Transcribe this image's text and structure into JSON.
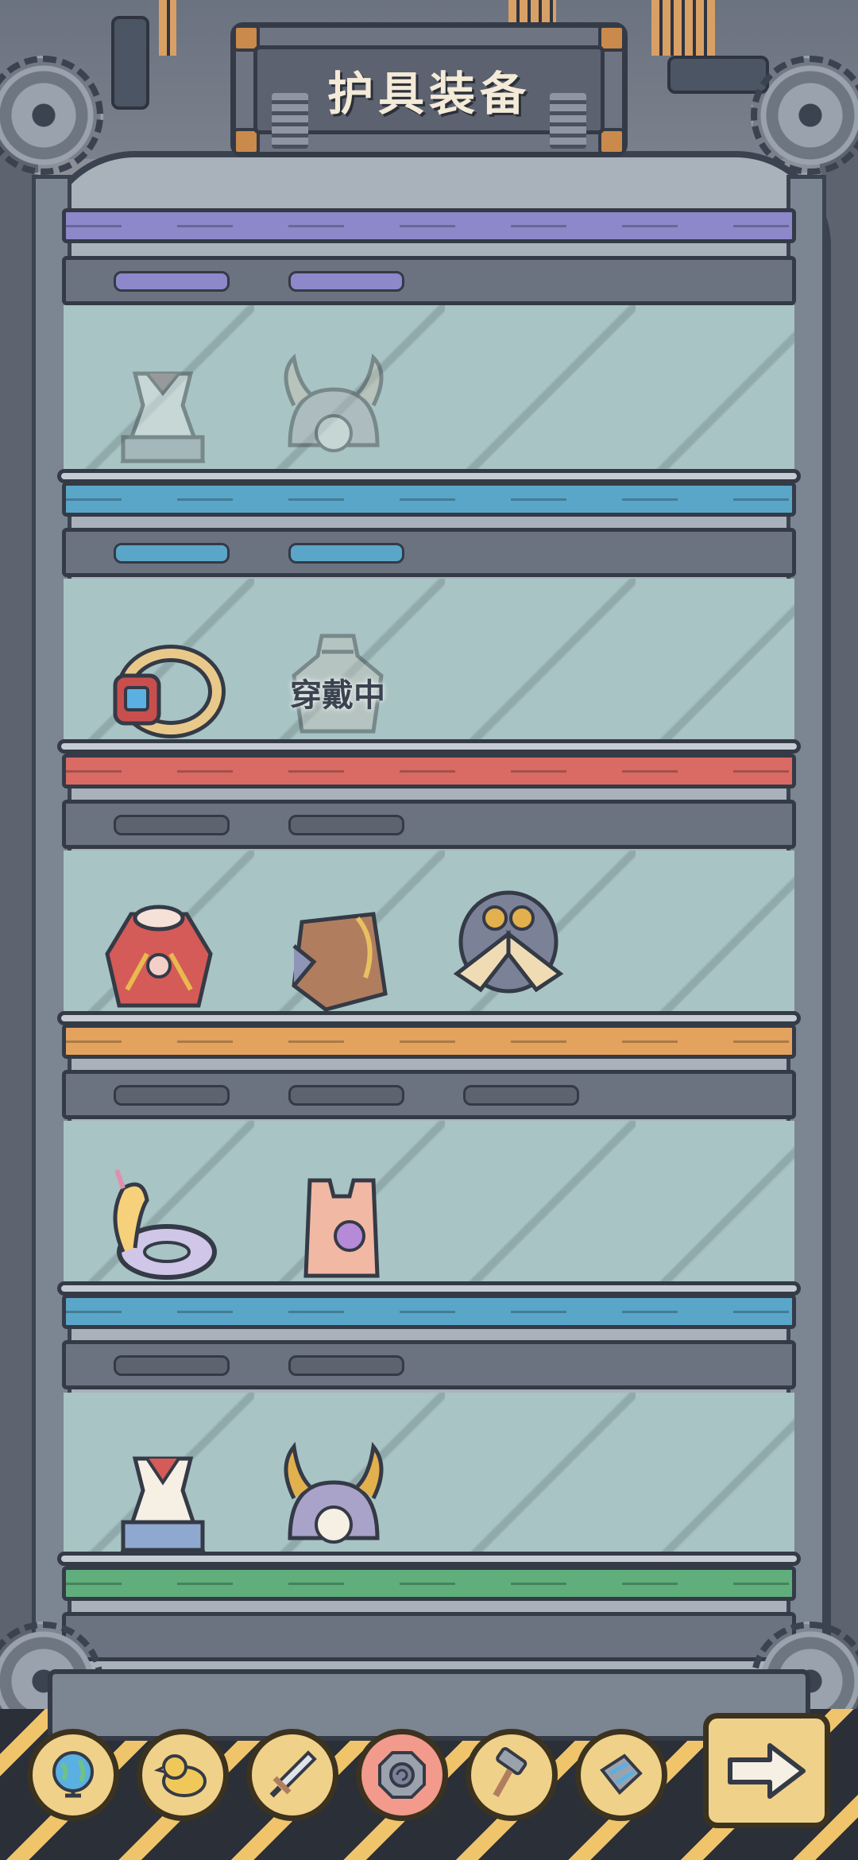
{
  "header": {
    "title": "护具装备"
  },
  "shelves": [
    {
      "items": [
        {
          "name": "sailor-dress",
          "owned": false
        },
        {
          "name": "horned-sheep-helmet",
          "owned": false
        }
      ]
    },
    {
      "items": [
        {
          "name": "jeweled-ring",
          "owned": true
        },
        {
          "name": "sack-armor",
          "owned": false,
          "equipped": true,
          "status_label": "穿戴中"
        }
      ]
    },
    {
      "items": [
        {
          "name": "red-cape-armor",
          "owned": true
        },
        {
          "name": "wooden-plate-armor",
          "owned": true
        },
        {
          "name": "winged-shield",
          "owned": true
        }
      ]
    },
    {
      "items": [
        {
          "name": "unicorn-swim-ring",
          "owned": true
        },
        {
          "name": "snail-vest",
          "owned": true
        }
      ]
    },
    {
      "items": [
        {
          "name": "sailor-dress",
          "owned": true
        },
        {
          "name": "horned-sheep-helmet",
          "owned": true
        }
      ]
    }
  ],
  "tabs": [
    {
      "name": "globe-icon",
      "active": false
    },
    {
      "name": "duck-icon",
      "active": false
    },
    {
      "name": "sword-icon",
      "active": false
    },
    {
      "name": "shield-icon",
      "active": true
    },
    {
      "name": "hammer-icon",
      "active": false
    },
    {
      "name": "gear-parts-icon",
      "active": false
    }
  ],
  "next_button": {
    "icon": "arrow-right-icon"
  },
  "colors": {
    "plank_1": "#5aa6c8",
    "plank_2": "#d96a64",
    "plank_3": "#e3a35e",
    "plank_4": "#5aa6c8",
    "plank_5": "#5fae7c",
    "plank_top": "#8d88c9",
    "active_tab": "#f29a8c",
    "tab": "#f0d189"
  }
}
